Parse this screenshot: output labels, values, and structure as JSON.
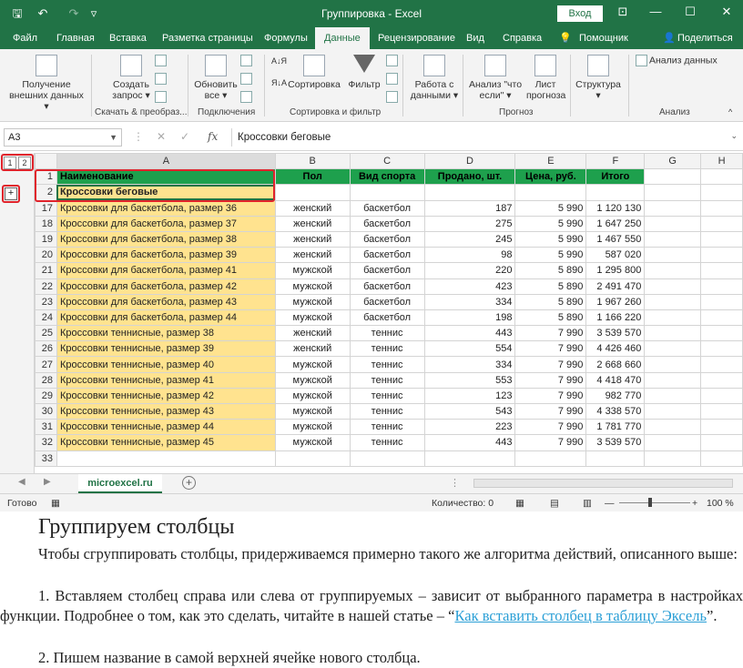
{
  "titlebar": {
    "title": "Группировка  -  Excel",
    "signin": "Вход",
    "save_glyph": "🖫",
    "undo_glyph": "↶",
    "redo_glyph": "↷",
    "qat_glyph": "▿",
    "ribbon_opts_glyph": "⊡",
    "min_glyph": "—",
    "max_glyph": "☐",
    "close_glyph": "✕"
  },
  "tabs": [
    {
      "label": "Файл"
    },
    {
      "label": "Главная"
    },
    {
      "label": "Вставка"
    },
    {
      "label": "Разметка страницы"
    },
    {
      "label": "Формулы"
    },
    {
      "label": "Данные"
    },
    {
      "label": "Рецензирование"
    },
    {
      "label": "Вид"
    },
    {
      "label": "Справка"
    },
    {
      "label": "Помощник"
    },
    {
      "label": "Поделиться"
    }
  ],
  "ribbon": {
    "get_external": "Получение внешних данных ▾",
    "create_query": "Создать запрос ▾",
    "refresh_all": "Обновить все ▾",
    "sort_asc": "А↓Я",
    "sort": "Сортировка",
    "filter": "Фильтр",
    "data_tools": "Работа с данными ▾",
    "what_if": "Анализ \"что если\" ▾",
    "forecast_sheet": "Лист прогноза",
    "outline": "Структура ▾",
    "data_analysis": "Анализ данных",
    "groups": {
      "get_transform": "Скачать & преобраз...",
      "connections": "Подключения",
      "sort_filter": "Сортировка и фильтр",
      "forecast": "Прогноз",
      "analysis": "Анализ"
    }
  },
  "formula_bar": {
    "cell_ref": "A3",
    "fx": "fx",
    "value": "Кроссовки беговые"
  },
  "grid": {
    "levels": [
      "1",
      "2"
    ],
    "col_letters": [
      "A",
      "B",
      "C",
      "D",
      "E",
      "F",
      "G",
      "H"
    ],
    "headers": [
      "Наименование",
      "Пол",
      "Вид спорта",
      "Продано, шт.",
      "Цена, руб.",
      "Итого"
    ],
    "group_row": {
      "num": "2",
      "label": "Кроссовки беговые"
    },
    "rows": [
      {
        "num": "17",
        "name": "Кроссовки для баскетбола, размер 36",
        "sex": "женский",
        "sport": "баскетбол",
        "sold": "187",
        "price": "5 990",
        "total": "1 120 130"
      },
      {
        "num": "18",
        "name": "Кроссовки для баскетбола, размер 37",
        "sex": "женский",
        "sport": "баскетбол",
        "sold": "275",
        "price": "5 990",
        "total": "1 647 250"
      },
      {
        "num": "19",
        "name": "Кроссовки для баскетбола, размер 38",
        "sex": "женский",
        "sport": "баскетбол",
        "sold": "245",
        "price": "5 990",
        "total": "1 467 550"
      },
      {
        "num": "20",
        "name": "Кроссовки для баскетбола, размер 39",
        "sex": "женский",
        "sport": "баскетбол",
        "sold": "98",
        "price": "5 990",
        "total": "587 020"
      },
      {
        "num": "21",
        "name": "Кроссовки для баскетбола, размер 41",
        "sex": "мужской",
        "sport": "баскетбол",
        "sold": "220",
        "price": "5 890",
        "total": "1 295 800"
      },
      {
        "num": "22",
        "name": "Кроссовки для баскетбола, размер 42",
        "sex": "мужской",
        "sport": "баскетбол",
        "sold": "423",
        "price": "5 890",
        "total": "2 491 470"
      },
      {
        "num": "23",
        "name": "Кроссовки для баскетбола, размер 43",
        "sex": "мужской",
        "sport": "баскетбол",
        "sold": "334",
        "price": "5 890",
        "total": "1 967 260"
      },
      {
        "num": "24",
        "name": "Кроссовки для баскетбола, размер 44",
        "sex": "мужской",
        "sport": "баскетбол",
        "sold": "198",
        "price": "5 890",
        "total": "1 166 220"
      },
      {
        "num": "25",
        "name": "Кроссовки теннисные, размер 38",
        "sex": "женский",
        "sport": "теннис",
        "sold": "443",
        "price": "7 990",
        "total": "3 539 570"
      },
      {
        "num": "26",
        "name": "Кроссовки теннисные, размер 39",
        "sex": "женский",
        "sport": "теннис",
        "sold": "554",
        "price": "7 990",
        "total": "4 426 460"
      },
      {
        "num": "27",
        "name": "Кроссовки теннисные, размер 40",
        "sex": "мужской",
        "sport": "теннис",
        "sold": "334",
        "price": "7 990",
        "total": "2 668 660"
      },
      {
        "num": "28",
        "name": "Кроссовки теннисные, размер 41",
        "sex": "мужской",
        "sport": "теннис",
        "sold": "553",
        "price": "7 990",
        "total": "4 418 470"
      },
      {
        "num": "29",
        "name": "Кроссовки теннисные, размер 42",
        "sex": "мужской",
        "sport": "теннис",
        "sold": "123",
        "price": "7 990",
        "total": "982 770"
      },
      {
        "num": "30",
        "name": "Кроссовки теннисные, размер 43",
        "sex": "мужской",
        "sport": "теннис",
        "sold": "543",
        "price": "7 990",
        "total": "4 338 570"
      },
      {
        "num": "31",
        "name": "Кроссовки теннисные, размер 44",
        "sex": "мужской",
        "sport": "теннис",
        "sold": "223",
        "price": "7 990",
        "total": "1 781 770"
      },
      {
        "num": "32",
        "name": "Кроссовки теннисные, размер 45",
        "sex": "мужской",
        "sport": "теннис",
        "sold": "443",
        "price": "7 990",
        "total": "3 539 570"
      }
    ],
    "row1_num": "1",
    "row_last_num": "33"
  },
  "sheet_tabs": {
    "active": "microexcel.ru"
  },
  "status": {
    "ready": "Готово",
    "count": "Количество: 0",
    "zoom": "100 %"
  },
  "doc": {
    "heading": "Группируем столбцы",
    "p1": "Чтобы сгруппировать столбцы, придерживаемся примерно такого же алгоритма действий, описанного выше:",
    "p2_before": "1. Вставляем столбец справа или слева от группируемых – зависит от выбранного параметра в настройках функции. Подробнее о том, как это сделать, читайте в нашей статье – “",
    "p2_link": "Как вставить столбец в таблицу Эксель",
    "p2_after": "”.",
    "p3": "2. Пишем название в самой верхней ячейке нового столбца."
  },
  "colors": {
    "brand": "#217346",
    "header_fill": "#1ea04d",
    "name_fill": "#ffe38f",
    "highlight": "#e0232b",
    "link": "#2a9fd6"
  }
}
